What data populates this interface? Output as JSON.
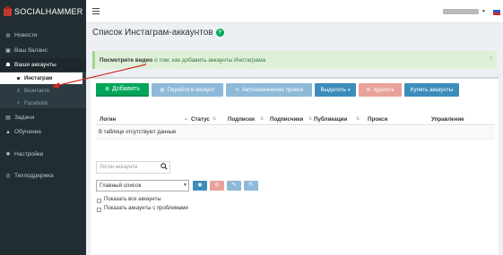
{
  "app": {
    "name": "SOCIALHAMMER",
    "flag_colors": [
      "#ffffff",
      "#2a57c8",
      "#d52b1e"
    ]
  },
  "sidebar": {
    "items": [
      {
        "label": "Новости",
        "icon": "globe-icon",
        "glyph": "◍"
      },
      {
        "label": "Ваш баланс",
        "icon": "wallet-icon",
        "glyph": "▣"
      },
      {
        "label": "Ваши аккаунты",
        "icon": "users-icon",
        "glyph": "☗"
      },
      {
        "label": "Задачи",
        "icon": "briefcase-icon",
        "glyph": "▤"
      },
      {
        "label": "Обучение",
        "icon": "graduation-cap-icon",
        "glyph": "▲"
      },
      {
        "label": "Настройки",
        "icon": "gear-icon",
        "glyph": "✹"
      },
      {
        "label": "Техподдержка",
        "icon": "lifebuoy-icon",
        "glyph": "◎"
      }
    ],
    "subitems": [
      {
        "label": "Инстаграм",
        "icon": "instagram-icon",
        "glyph": "◙"
      },
      {
        "label": "Вконтакте",
        "icon": "vk-icon",
        "glyph": "ʬ"
      },
      {
        "label": "Facebook",
        "icon": "facebook-icon",
        "glyph": "f"
      }
    ]
  },
  "main": {
    "title": "Список Инстаграм-аккаунтов",
    "help_glyph": "?",
    "alert": {
      "bold": "Посмотрите видео",
      "text": "о том, как добавить аккаунты Инстаграма",
      "close": "×"
    },
    "toolbar": {
      "add": "Добавить",
      "goto": "Перейти в аккаунт",
      "proxy": "Автоназначение прокси",
      "select": "Выделить",
      "delete": "Удалить",
      "buy": "Купить аккаунты"
    },
    "table": {
      "columns": [
        "Логин",
        "Статус",
        "Подписки",
        "Подписчики",
        "Публикации",
        "Прокси",
        "Управление"
      ],
      "empty": "В таблице отсутствуют данные"
    },
    "search_placeholder": "Логин аккаунта",
    "list_select": "Главный список",
    "checkboxes": [
      "Показать все аккаунты",
      "Показать аккаунты с проблемами"
    ],
    "colors": {
      "accent_green": "#00a65a",
      "primary_blue": "#3c8dbc",
      "annotation_red": "#d0281f"
    }
  }
}
